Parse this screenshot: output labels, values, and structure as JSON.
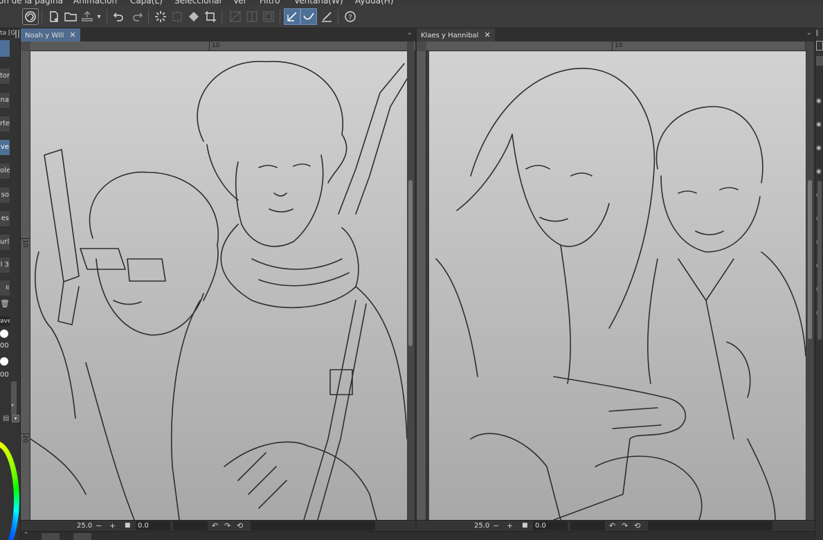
{
  "menu": [
    "Animación",
    "Capa(L)",
    "Seleccionar",
    "Ver",
    "Filtro",
    "Ventana(W)",
    "Ayuda(H)"
  ],
  "menu_partial_left": "ón de la página",
  "toolbar": {
    "icons": [
      "app-logo-icon",
      "new-file-icon",
      "open-folder-icon",
      "export-icon",
      "undo-icon",
      "redo-icon",
      "busy-spinner-icon",
      "transform-select-icon",
      "fill-icon",
      "crop-icon",
      "disabled-a-icon",
      "disabled-b-icon",
      "disabled-c-icon",
      "pen-active-icon",
      "pen-stabilize-icon",
      "pen-line-icon",
      "help-icon"
    ]
  },
  "left_panel": {
    "title_partial": "ta [G",
    "items": [
      "tor",
      "na",
      "rte",
      "ve",
      "ole",
      "so",
      "es",
      "url",
      "l 3",
      "II"
    ],
    "selected_item_index": 3,
    "layer_label": "ave]",
    "numbers": [
      "00",
      "00"
    ]
  },
  "documents": [
    {
      "tab": "Noah y Will",
      "active": true,
      "ruler_top_label": "10",
      "ruler_left_labels": [
        "10",
        "20"
      ],
      "zoom": "25.0",
      "rotation": "0.0"
    },
    {
      "tab": "Klaes y Hannibal",
      "active": false,
      "ruler_top_label": "10",
      "ruler_left_labels": [],
      "zoom": "25.0",
      "rotation": "0.0"
    }
  ],
  "colors": {
    "accent": "#4e6f96",
    "dock": "#333333",
    "canvas_top": "#d2d2d2",
    "canvas_bottom": "#a8a8a8"
  }
}
